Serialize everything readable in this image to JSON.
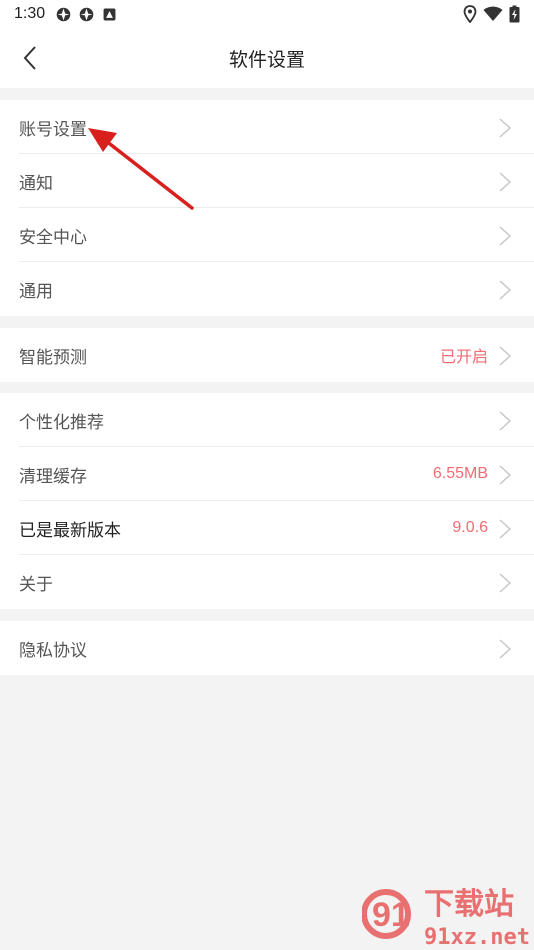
{
  "status_bar": {
    "time": "1:30",
    "left_icons": [
      "app-icon",
      "app-icon",
      "notification-icon"
    ],
    "right_icons": [
      "location-icon",
      "wifi-icon",
      "battery-icon"
    ]
  },
  "header": {
    "title": "软件设置"
  },
  "groups": [
    {
      "items": [
        {
          "label": "账号设置"
        },
        {
          "label": "通知"
        },
        {
          "label": "安全中心"
        },
        {
          "label": "通用"
        }
      ]
    },
    {
      "items": [
        {
          "label": "智能预测",
          "value": "已开启"
        }
      ]
    },
    {
      "items": [
        {
          "label": "个性化推荐"
        },
        {
          "label": "清理缓存",
          "value": "6.55MB"
        },
        {
          "label": "已是最新版本",
          "value": "9.0.6"
        },
        {
          "label": "关于"
        }
      ]
    },
    {
      "items": [
        {
          "label": "隐私协议"
        }
      ]
    }
  ],
  "watermark": {
    "text_cn": "下载站",
    "text_url": "91xz.net",
    "logo_text": "91"
  },
  "colors": {
    "accent_value": "#f16b72",
    "annotation_arrow": "#d8201c",
    "background": "#f3f3f3"
  }
}
